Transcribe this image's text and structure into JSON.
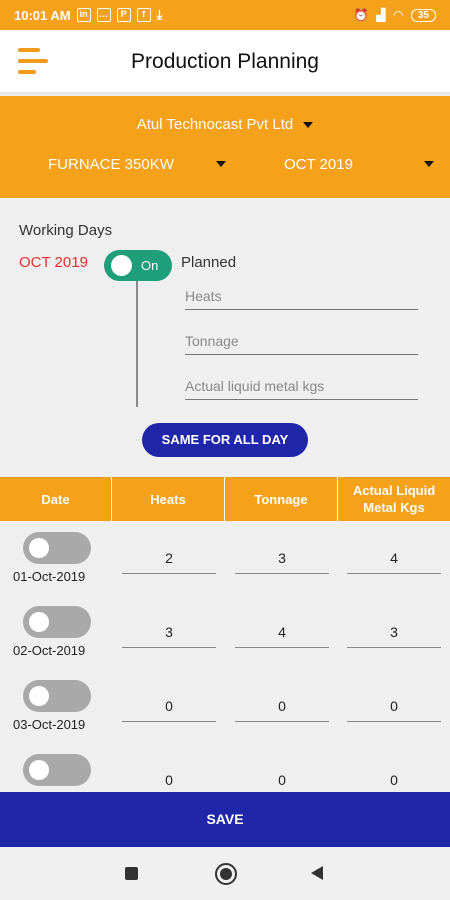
{
  "status": {
    "time": "10:01 AM",
    "battery": "35"
  },
  "header": {
    "title": "Production Planning"
  },
  "filters": {
    "company": "Atul Technocast Pvt Ltd",
    "furnace": "FURNACE 350KW",
    "month": "OCT 2019"
  },
  "working": {
    "label": "Working Days",
    "month": "OCT 2019",
    "toggle_label": "On",
    "planned_label": "Planned"
  },
  "fields": {
    "heats_placeholder": "Heats",
    "tonnage_placeholder": "Tonnage",
    "liquid_placeholder": "Actual liquid metal kgs"
  },
  "same_button": "SAME FOR ALL DAY",
  "table": {
    "headers": [
      "Date",
      "Heats",
      "Tonnage",
      "Actual Liquid Metal Kgs"
    ],
    "rows": [
      {
        "date": "01-Oct-2019",
        "heats": "2",
        "tonnage": "3",
        "liquid": "4"
      },
      {
        "date": "02-Oct-2019",
        "heats": "3",
        "tonnage": "4",
        "liquid": "3"
      },
      {
        "date": "03-Oct-2019",
        "heats": "0",
        "tonnage": "0",
        "liquid": "0"
      },
      {
        "date": "",
        "heats": "0",
        "tonnage": "0",
        "liquid": "0"
      }
    ]
  },
  "save_button": "SAVE"
}
